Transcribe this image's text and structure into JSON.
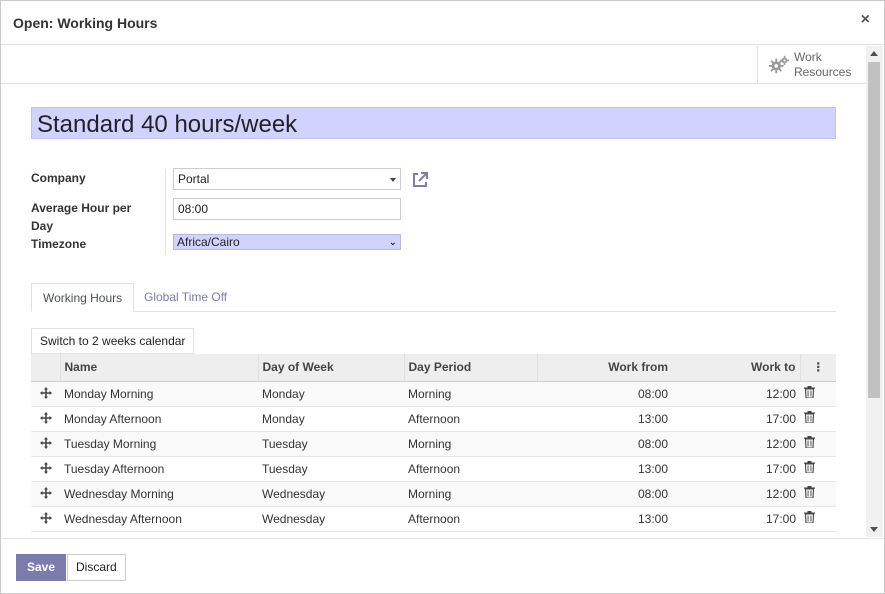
{
  "dialog": {
    "title": "Open: Working Hours",
    "close_label": "×"
  },
  "smart_button": {
    "line1": "Work",
    "line2": "Resources",
    "icon": "gears-icon"
  },
  "record": {
    "name": "Standard 40 hours/week"
  },
  "fields": {
    "company_label": "Company",
    "company_value": "Portal",
    "avg_hours_label_1": "Average Hour per",
    "avg_hours_label_2": "Day",
    "avg_hours_value": "08:00",
    "timezone_label": "Timezone",
    "timezone_value": "Africa/Cairo"
  },
  "tabs": [
    {
      "label": "Working Hours",
      "active": true
    },
    {
      "label": "Global Time Off",
      "active": false
    }
  ],
  "switch_button": "Switch to 2 weeks calendar",
  "table": {
    "headers": [
      "Name",
      "Day of Week",
      "Day Period",
      "Work from",
      "Work to"
    ],
    "rows": [
      [
        "Monday Morning",
        "Monday",
        "Morning",
        "08:00",
        "12:00"
      ],
      [
        "Monday Afternoon",
        "Monday",
        "Afternoon",
        "13:00",
        "17:00"
      ],
      [
        "Tuesday Morning",
        "Tuesday",
        "Morning",
        "08:00",
        "12:00"
      ],
      [
        "Tuesday Afternoon",
        "Tuesday",
        "Afternoon",
        "13:00",
        "17:00"
      ],
      [
        "Wednesday Morning",
        "Wednesday",
        "Morning",
        "08:00",
        "12:00"
      ],
      [
        "Wednesday Afternoon",
        "Wednesday",
        "Afternoon",
        "13:00",
        "17:00"
      ]
    ]
  },
  "footer": {
    "save_label": "Save",
    "discard_label": "Discard"
  },
  "colors": {
    "accent": "#7c7bad",
    "required_field_bg": "#d2d2ff"
  }
}
